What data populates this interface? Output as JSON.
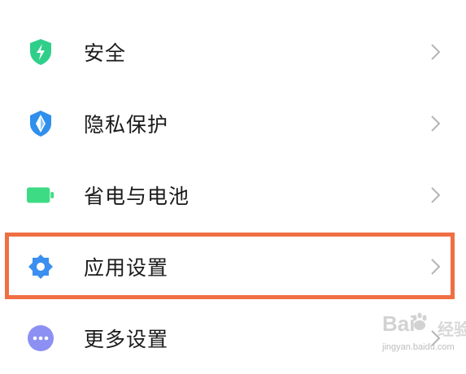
{
  "settings_list": {
    "items": [
      {
        "label": "安全",
        "icon": "shield-bolt-icon",
        "icon_color": "#2fcf8a"
      },
      {
        "label": "隐私保护",
        "icon": "privacy-shield-icon",
        "icon_color": "#2f8fec"
      },
      {
        "label": "省电与电池",
        "icon": "battery-icon",
        "icon_color": "#3ddc84"
      },
      {
        "label": "应用设置",
        "icon": "gear-icon",
        "icon_color": "#3a8ff0",
        "highlighted": true
      },
      {
        "label": "更多设置",
        "icon": "more-dots-icon",
        "icon_color": "#8c90f2"
      }
    ],
    "chevron_icon": "chevron-right-icon"
  },
  "highlight_color": "#ef6f43",
  "watermark": {
    "brand": "Bai",
    "brand_tail": "经验",
    "url": "jingyan.baidu.com"
  }
}
